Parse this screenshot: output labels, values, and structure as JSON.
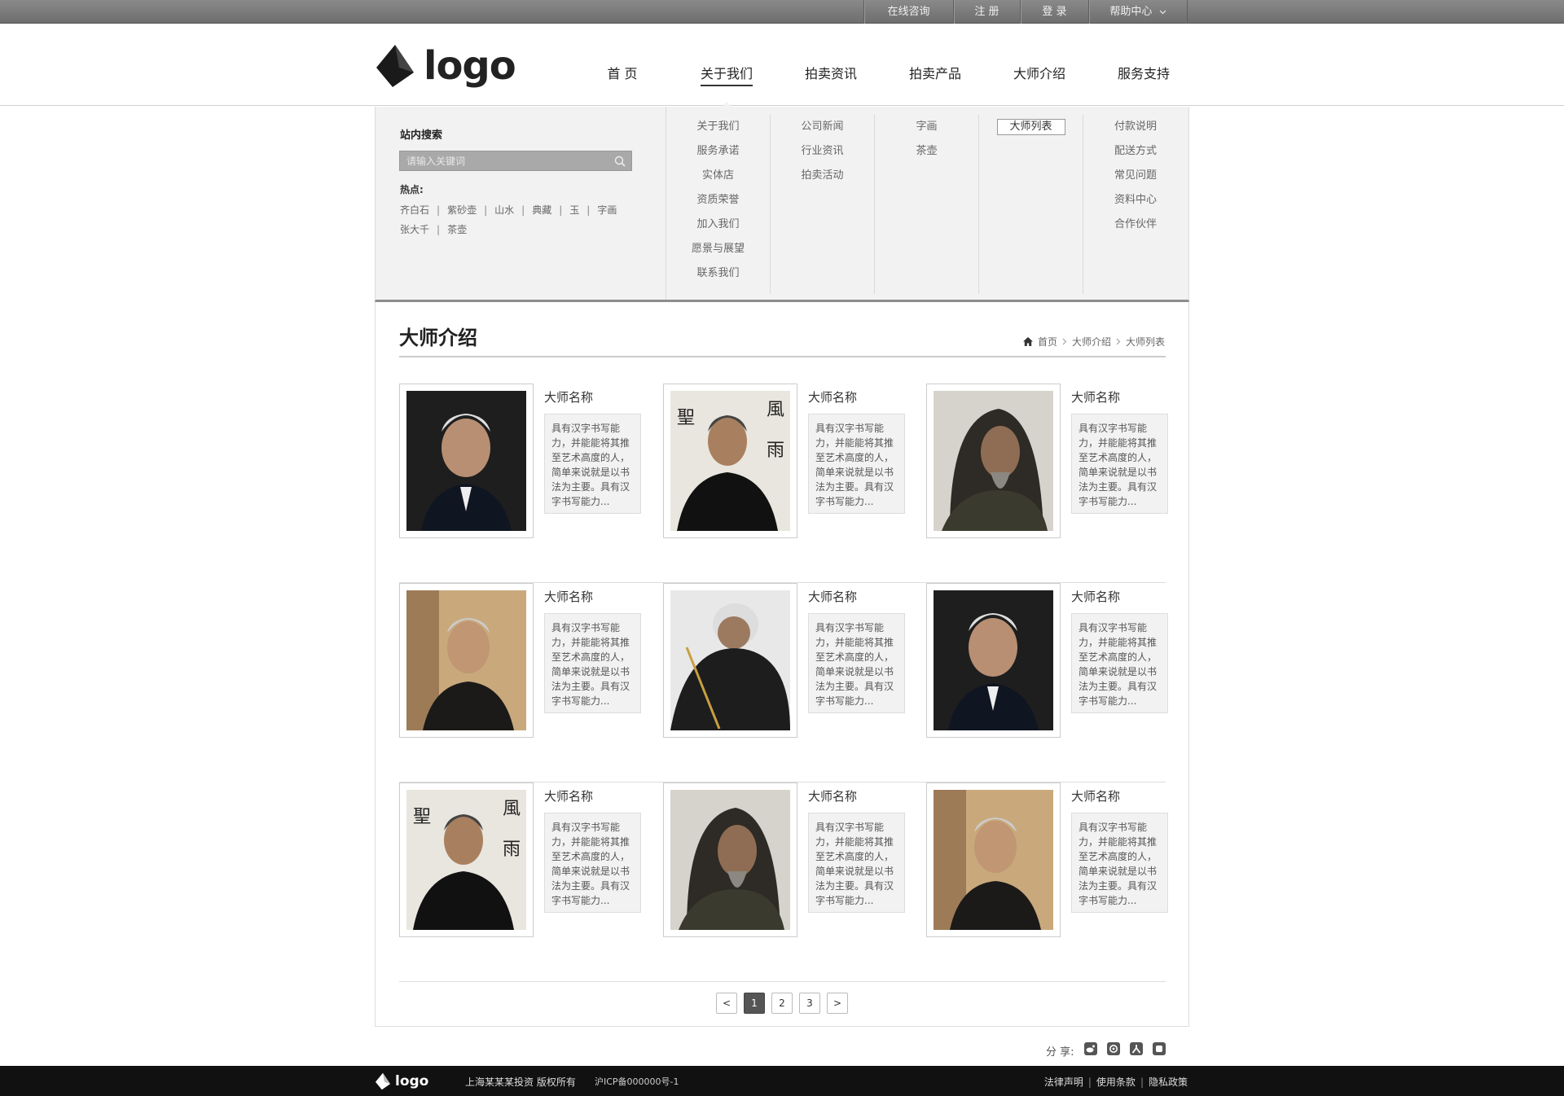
{
  "topbar": {
    "links": [
      "在线咨询",
      "注 册",
      "登 录",
      "帮助中心"
    ]
  },
  "header": {
    "logo_text": "logo",
    "nav": [
      "首 页",
      "关于我们",
      "拍卖资讯",
      "拍卖产品",
      "大师介绍",
      "服务支持"
    ]
  },
  "dropdown": {
    "search_title": "站内搜索",
    "search_placeholder": "请输入关键词",
    "hot_label": "热点:",
    "hot_items": [
      "齐白石",
      "紫砂壶",
      "山水",
      "典藏",
      "玉",
      "字画",
      "张大千",
      "茶壶"
    ],
    "columns": [
      [
        "关于我们",
        "服务承诺",
        "实体店",
        "资质荣誉",
        "加入我们",
        "愿景与展望",
        "联系我们"
      ],
      [
        "公司新闻",
        "行业资讯",
        "拍卖活动"
      ],
      [
        "字画",
        "茶壶"
      ],
      [
        "大师列表"
      ],
      [
        "付款说明",
        "配送方式",
        "常见问题",
        "资料中心",
        "合作伙伴"
      ]
    ]
  },
  "content": {
    "title": "大师介绍",
    "breadcrumb": [
      "首页",
      "大师介绍",
      "大师列表"
    ],
    "cards": [
      {
        "name": "大师名称",
        "desc": "具有汉字书写能力，并能能将其推至艺术高度的人，简单来说就是以书法为主要。具有汉字书写能力..."
      },
      {
        "name": "大师名称",
        "desc": "具有汉字书写能力，并能能将其推至艺术高度的人，简单来说就是以书法为主要。具有汉字书写能力..."
      },
      {
        "name": "大师名称",
        "desc": "具有汉字书写能力，并能能将其推至艺术高度的人，简单来说就是以书法为主要。具有汉字书写能力..."
      },
      {
        "name": "大师名称",
        "desc": "具有汉字书写能力，并能能将其推至艺术高度的人，简单来说就是以书法为主要。具有汉字书写能力..."
      },
      {
        "name": "大师名称",
        "desc": "具有汉字书写能力，并能能将其推至艺术高度的人，简单来说就是以书法为主要。具有汉字书写能力..."
      },
      {
        "name": "大师名称",
        "desc": "具有汉字书写能力，并能能将其推至艺术高度的人，简单来说就是以书法为主要。具有汉字书写能力..."
      },
      {
        "name": "大师名称",
        "desc": "具有汉字书写能力，并能能将其推至艺术高度的人，简单来说就是以书法为主要。具有汉字书写能力..."
      },
      {
        "name": "大师名称",
        "desc": "具有汉字书写能力，并能能将其推至艺术高度的人，简单来说就是以书法为主要。具有汉字书写能力..."
      },
      {
        "name": "大师名称",
        "desc": "具有汉字书写能力，并能能将其推至艺术高度的人，简单来说就是以书法为主要。具有汉字书写能力..."
      }
    ],
    "pager": [
      "<",
      "1",
      "2",
      "3",
      ">"
    ]
  },
  "share": {
    "label": "分 享:"
  },
  "footer": {
    "logo_text": "logo",
    "copyright": "上海某某某投资 版权所有",
    "icp": "沪ICP备000000号-1",
    "links": [
      "法律声明",
      "使用条款",
      "隐私政策"
    ]
  }
}
